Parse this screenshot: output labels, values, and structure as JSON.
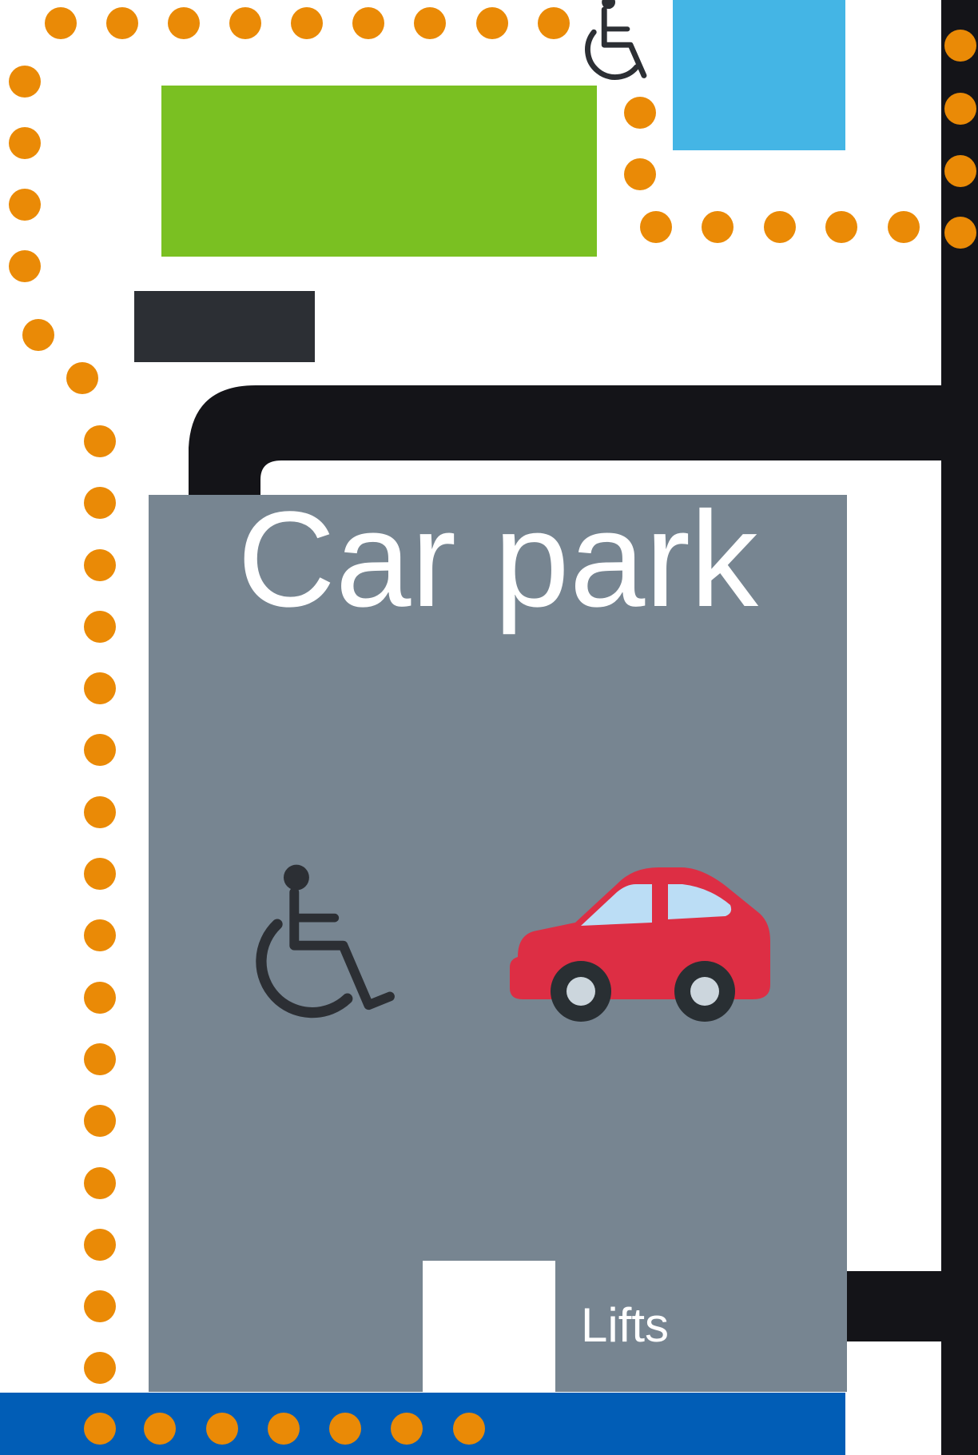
{
  "labels": {
    "car_park": "Car park",
    "lifts": "Lifts"
  },
  "icons": {
    "accessible_parking": "wheelchair-icon",
    "parking": "car-icon",
    "accessible_entrance": "wheelchair-icon"
  },
  "colors": {
    "footpath_dots": "#ea8a06",
    "road": "#141418",
    "car_park": "#778591",
    "green_area": "#7ac022",
    "water_area": "#44b5e5",
    "dark_block": "#2c2f34",
    "bottom_band": "#015db6",
    "car_body": "#dd2e44",
    "car_window": "#bbddf5"
  }
}
